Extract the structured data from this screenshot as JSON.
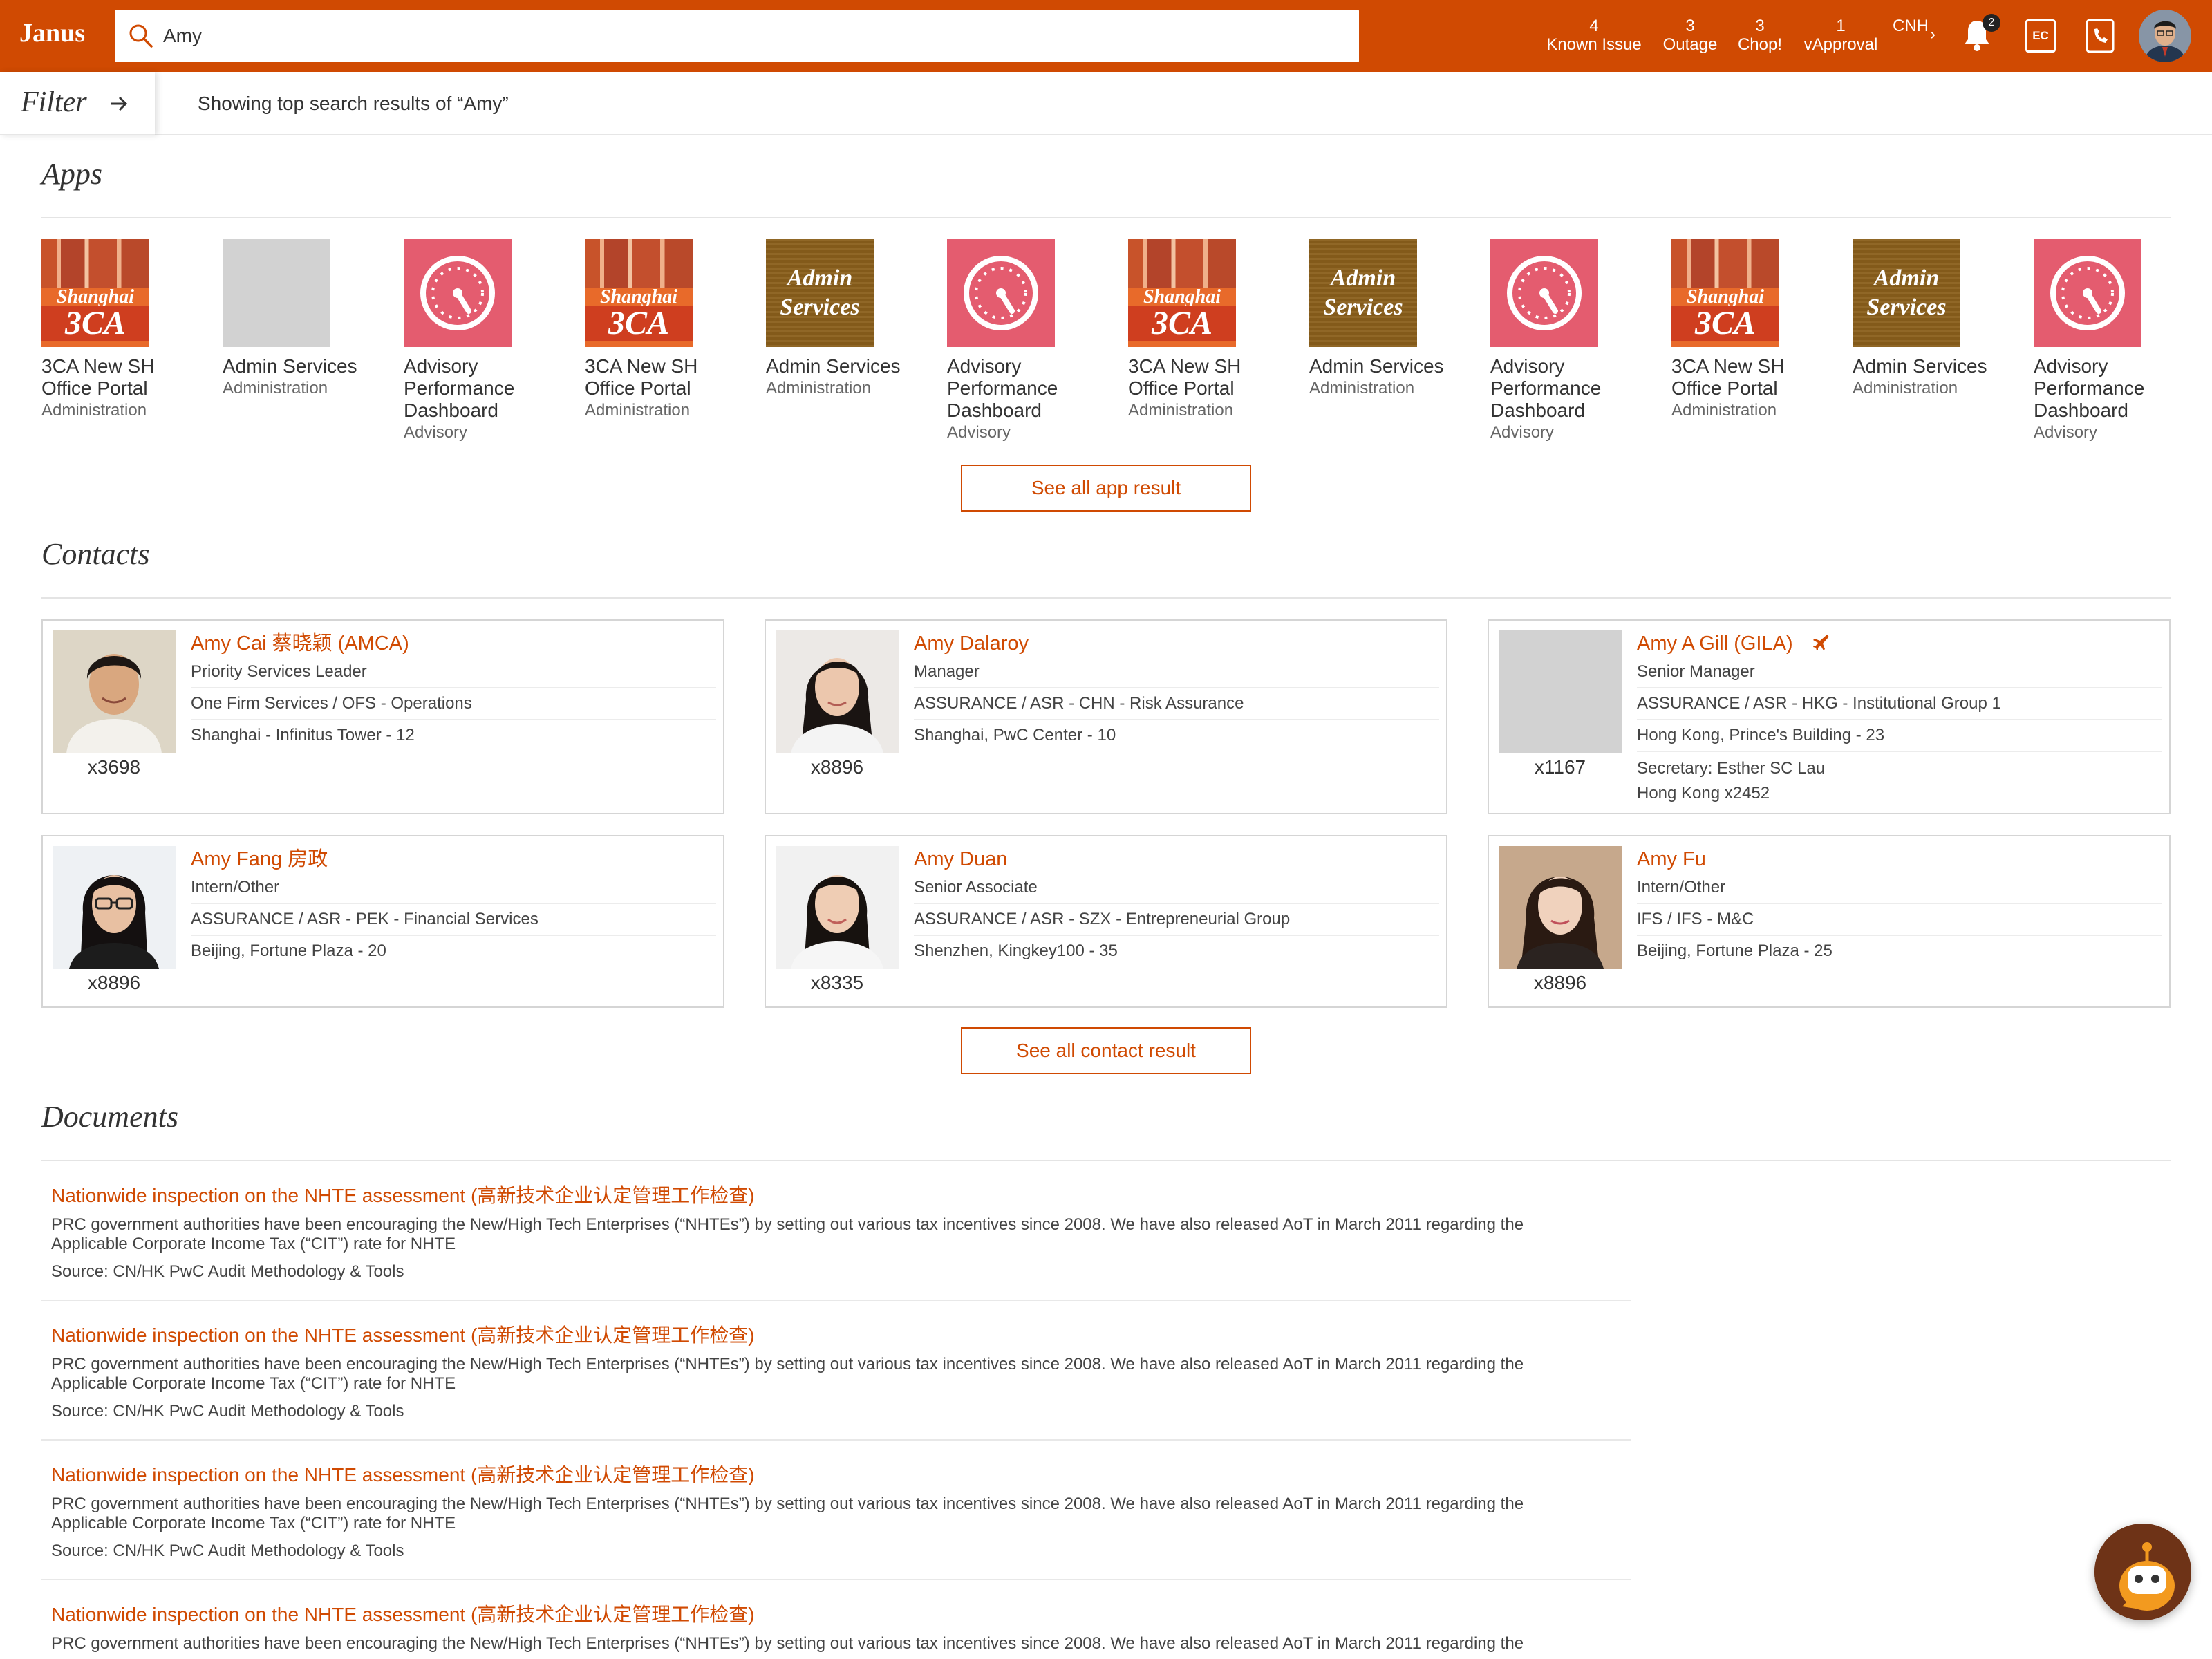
{
  "header": {
    "logo": "Janus",
    "search_value": "Amy",
    "stats": [
      {
        "count": "4",
        "label": "Known Issue"
      },
      {
        "count": "3",
        "label": "Outage"
      },
      {
        "count": "3",
        "label": "Chop!"
      },
      {
        "count": "1",
        "label": "vApproval"
      },
      {
        "count": "",
        "label": "CNH"
      }
    ],
    "notification_count": "2",
    "ec_label": "EC",
    "colors": {
      "brand": "#d04a02"
    }
  },
  "filter": {
    "label": "Filter",
    "showing_text": "Showing top search results of “Amy”"
  },
  "apps": {
    "title": "Apps",
    "items": [
      {
        "name": "3CA New SH Office Portal",
        "category": "Administration",
        "icon": "shanghai-3ca"
      },
      {
        "name": "Admin Services",
        "category": "Administration",
        "icon": "placeholder"
      },
      {
        "name": "Advisory Performance Dashboard",
        "category": "Advisory",
        "icon": "gauge"
      },
      {
        "name": "3CA New SH Office Portal",
        "category": "Administration",
        "icon": "shanghai-3ca"
      },
      {
        "name": "Admin Services",
        "category": "Administration",
        "icon": "admin-services"
      },
      {
        "name": "Advisory Performance Dashboard",
        "category": "Advisory",
        "icon": "gauge"
      },
      {
        "name": "3CA New SH Office Portal",
        "category": "Administration",
        "icon": "shanghai-3ca"
      },
      {
        "name": "Admin Services",
        "category": "Administration",
        "icon": "admin-services"
      },
      {
        "name": "Advisory Performance Dashboard",
        "category": "Advisory",
        "icon": "gauge"
      },
      {
        "name": "3CA New SH Office Portal",
        "category": "Administration",
        "icon": "shanghai-3ca"
      },
      {
        "name": "Admin Services",
        "category": "Administration",
        "icon": "admin-services"
      },
      {
        "name": "Advisory Performance Dashboard",
        "category": "Advisory",
        "icon": "gauge"
      }
    ],
    "tile_text": {
      "shanghai": "Shanghai",
      "tca": "3CA",
      "admin": "Admin",
      "services": "Services"
    },
    "see_all": "See all app result"
  },
  "contacts": {
    "title": "Contacts",
    "items": [
      {
        "name": "Amy Cai 蔡晓颖 (AMCA)",
        "title": "Priority Services Leader",
        "dept": "One Firm Services / OFS - Operations",
        "location": "Shanghai - Infinitus Tower - 12",
        "ext": "x3698"
      },
      {
        "name": "Amy Dalaroy",
        "title": "Manager",
        "dept": "ASSURANCE / ASR - CHN - Risk Assurance",
        "location": "Shanghai, PwC Center - 10",
        "ext": "x8896"
      },
      {
        "name": "Amy A Gill (GILA)",
        "title": "Senior Manager",
        "dept": "ASSURANCE / ASR - HKG - Institutional Group 1",
        "location": "Hong Kong, Prince's Building - 23",
        "ext": "x1167",
        "secretary": "Secretary: Esther SC Lau",
        "secretary_ext": "Hong Kong x2452",
        "travel_icon": "airplane-icon"
      },
      {
        "name": "Amy Fang 房政",
        "title": "Intern/Other",
        "dept": "ASSURANCE / ASR - PEK - Financial Services",
        "location": "Beijing, Fortune Plaza - 20",
        "ext": "x8896"
      },
      {
        "name": "Amy Duan",
        "title": "Senior Associate",
        "dept": "ASSURANCE / ASR - SZX - Entrepreneurial Group",
        "location": "Shenzhen, Kingkey100 - 35",
        "ext": "x8335"
      },
      {
        "name": "Amy Fu",
        "title": "Intern/Other",
        "dept": "IFS / IFS - M&C",
        "location": "Beijing, Fortune Plaza - 25",
        "ext": "x8896"
      }
    ],
    "see_all": "See all contact result"
  },
  "documents": {
    "title": "Documents",
    "items": [
      {
        "title": "Nationwide inspection on the NHTE assessment (高新技术企业认定管理工作检查)",
        "desc": "PRC government authorities have been encouraging the New/High Tech Enterprises (“NHTEs”) by setting out various tax incentives since 2008. We have also released AoT in March 2011 regarding the Applicable Corporate Income Tax (“CIT”) rate for NHTE",
        "source": "Source: CN/HK PwC Audit Methodology & Tools"
      },
      {
        "title": "Nationwide inspection on the NHTE assessment (高新技术企业认定管理工作检查)",
        "desc": "PRC government authorities have been encouraging the New/High Tech Enterprises (“NHTEs”) by setting out various tax incentives since 2008. We have also released AoT in March 2011 regarding the Applicable Corporate Income Tax (“CIT”) rate for NHTE",
        "source": "Source: CN/HK PwC Audit Methodology & Tools"
      },
      {
        "title": "Nationwide inspection on the NHTE assessment (高新技术企业认定管理工作检查)",
        "desc": "PRC government authorities have been encouraging the New/High Tech Enterprises (“NHTEs”) by setting out various tax incentives since 2008. We have also released AoT in March 2011 regarding the Applicable Corporate Income Tax (“CIT”) rate for NHTE",
        "source": "Source: CN/HK PwC Audit Methodology & Tools"
      },
      {
        "title": "Nationwide inspection on the NHTE assessment (高新技术企业认定管理工作检查)",
        "desc": "PRC government authorities have been encouraging the New/High Tech Enterprises (“NHTEs”) by setting out various tax incentives since 2008. We have also released AoT in March 2011 regarding the",
        "source": ""
      }
    ]
  }
}
